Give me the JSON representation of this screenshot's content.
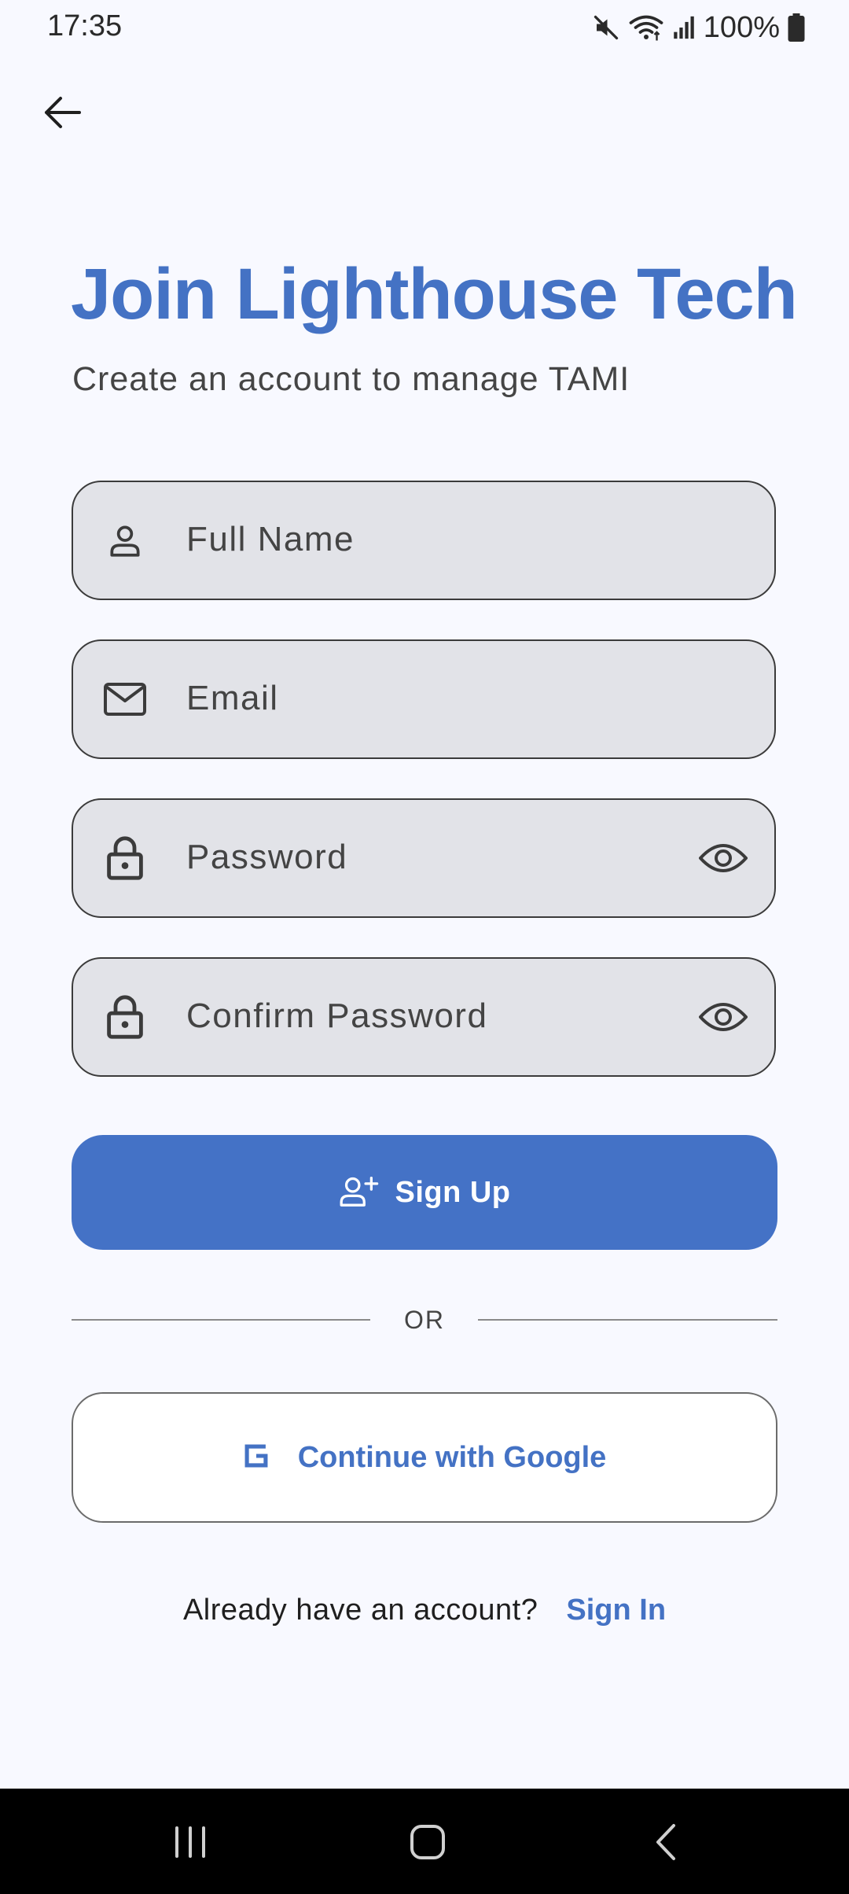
{
  "status_bar": {
    "time": "17:35",
    "battery": "100%",
    "icons": [
      "mute-icon",
      "wifi-icon",
      "signal-icon",
      "battery-icon"
    ]
  },
  "header": {
    "back_icon": "arrow-left-icon"
  },
  "title": "Join Lighthouse Tech",
  "subtitle": "Create an account to manage TAMI",
  "form": {
    "full_name": {
      "placeholder": "Full Name",
      "icon": "person-icon"
    },
    "email": {
      "placeholder": "Email",
      "icon": "mail-icon"
    },
    "password": {
      "placeholder": "Password",
      "icon": "lock-icon",
      "toggle_icon": "eye-icon"
    },
    "confirm_password": {
      "placeholder": "Confirm Password",
      "icon": "lock-icon",
      "toggle_icon": "eye-icon"
    }
  },
  "signup_button": {
    "label": "Sign Up",
    "icon": "person-add-icon"
  },
  "divider": {
    "label": "OR"
  },
  "google_button": {
    "label": "Continue with Google",
    "icon": "google-g-icon"
  },
  "signin": {
    "prompt": "Already have an account?",
    "link": "Sign In"
  },
  "colors": {
    "accent": "#4472c4",
    "background": "#f8f9ff",
    "field_fill": "#e2e3e8"
  }
}
